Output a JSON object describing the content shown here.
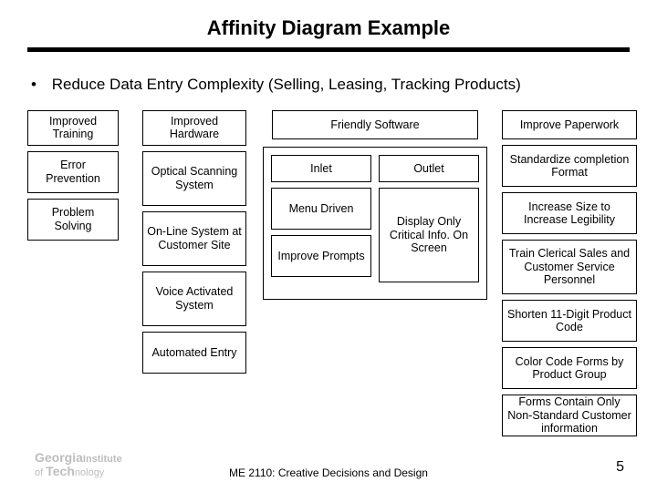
{
  "title": "Affinity Diagram Example",
  "subtitle": "Reduce Data Entry Complexity (Selling, Leasing, Tracking Products)",
  "cols": {
    "training": {
      "head": "Improved Training",
      "items": [
        "Error Prevention",
        "Problem Solving"
      ]
    },
    "hardware": {
      "head": "Improved Hardware",
      "items": [
        "Optical Scanning System",
        "On-Line System at Customer Site",
        "Voice Activated System",
        "Automated Entry"
      ]
    },
    "software": {
      "head": "Friendly Software",
      "inlet": {
        "head": "Inlet",
        "items": [
          "Menu Driven",
          "Improve Prompts"
        ]
      },
      "outlet": {
        "head": "Outlet",
        "items": [
          "Display Only Critical Info. On Screen"
        ]
      }
    },
    "paperwork": {
      "head": "Improve Paperwork",
      "items": [
        "Standardize completion Format",
        "Increase Size to Increase Legibility",
        "Train Clerical Sales and Customer Service Personnel",
        "Shorten 11-Digit Product Code",
        "Color Code Forms by Product Group",
        "Forms Contain Only Non-Standard Customer information"
      ]
    }
  },
  "footer": {
    "course": "ME 2110: Creative Decisions and Design",
    "page": "5",
    "logo1": "Georgia",
    "logo2": "Institute",
    "logo3": "of",
    "logo4": "Tech",
    "logo5": "nology"
  }
}
